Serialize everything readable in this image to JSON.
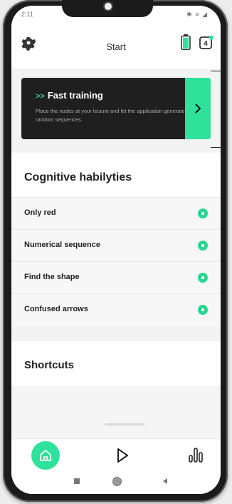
{
  "status": {
    "time": "2:11",
    "right": "✱ ≡ ◢"
  },
  "header": {
    "title": "Start",
    "notification_count": "4"
  },
  "banner": {
    "title": "Fast training",
    "arrow": ">>",
    "description": "Place the nodes at your leisure and let the application generate random sequences."
  },
  "cognitive": {
    "title": "Cognitive habilyties",
    "items": [
      {
        "label": "Only red"
      },
      {
        "label": "Numerical sequence"
      },
      {
        "label": "Find the shape"
      },
      {
        "label": "Confused arrows"
      }
    ]
  },
  "shortcuts": {
    "title": "Shortcuts"
  },
  "colors": {
    "accent": "#2fe29c",
    "banner_bg": "#1f1f1f"
  },
  "nav": {
    "home_icon": "home-icon",
    "play_icon": "play-icon",
    "stats_icon": "stats-icon"
  }
}
